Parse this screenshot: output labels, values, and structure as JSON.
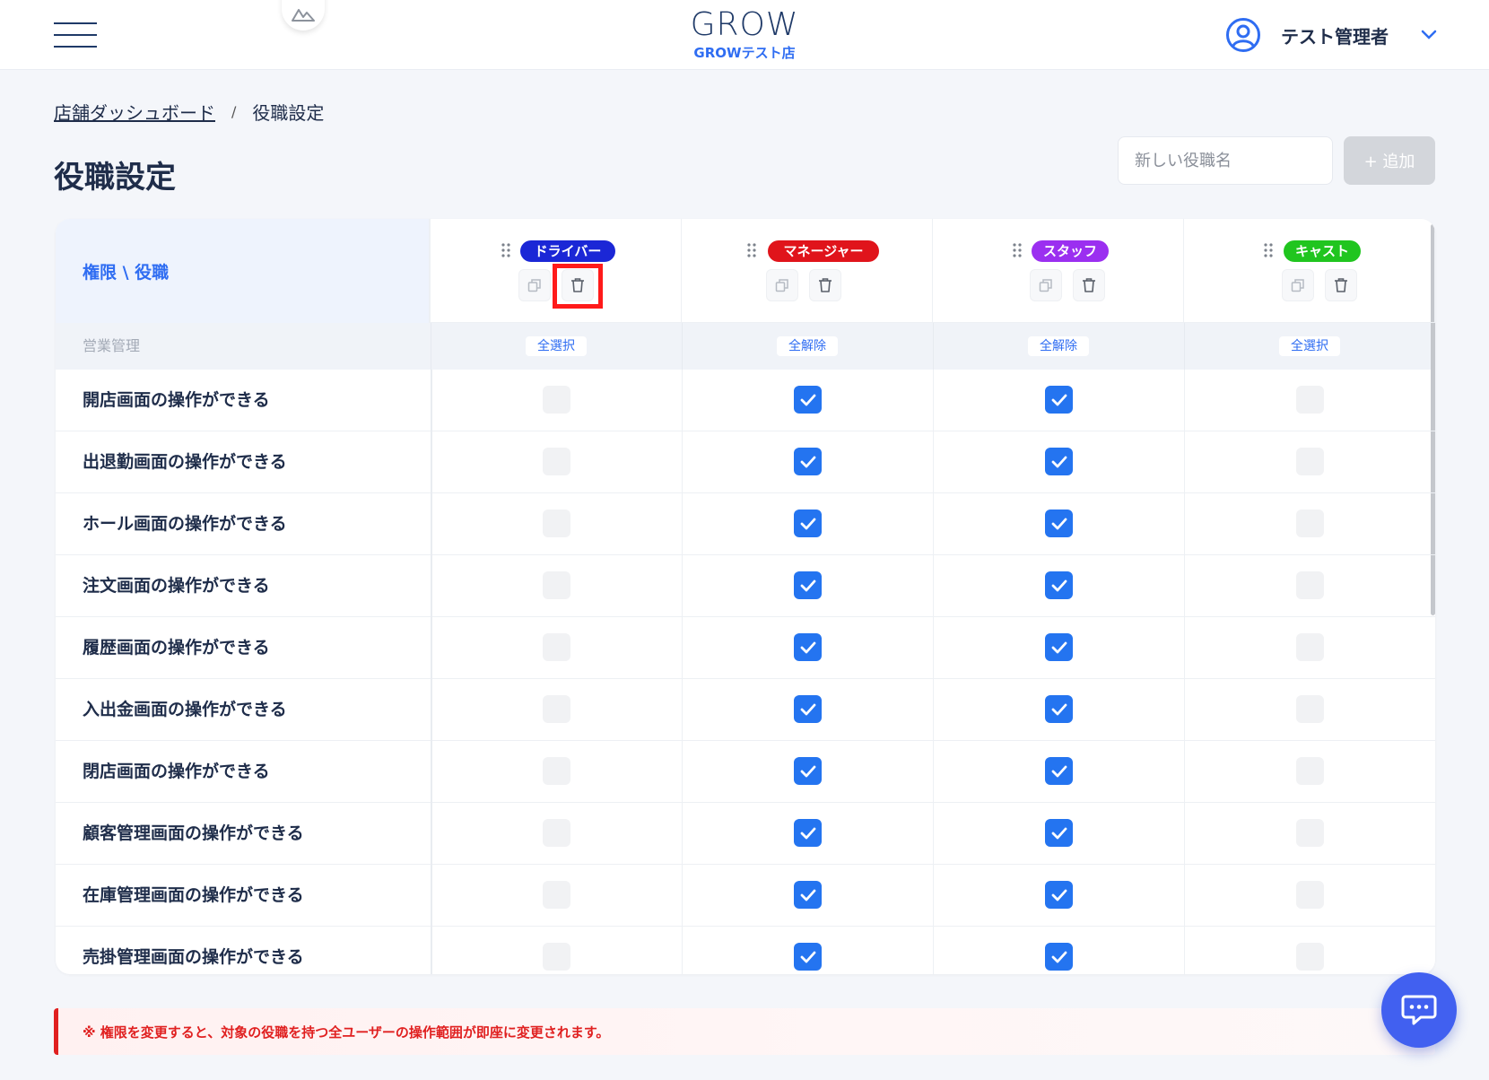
{
  "header": {
    "brand_title": "GROW",
    "brand_subtitle": "GROWテスト店",
    "user_name": "テスト管理者"
  },
  "breadcrumb": {
    "parent": "店舗ダッシュボード",
    "separator": "/",
    "current": "役職設定"
  },
  "page": {
    "title": "役職設定",
    "new_role_placeholder": "新しい役職名",
    "add_button_label": "+ 追加"
  },
  "table": {
    "corner_label": "権限 \\ 役職",
    "roles": [
      {
        "name": "ドライバー",
        "color": "#1b27d6"
      },
      {
        "name": "マネージャー",
        "color": "#e0141b"
      },
      {
        "name": "スタッフ",
        "color": "#9b2ff0"
      },
      {
        "name": "キャスト",
        "color": "#20c51f"
      }
    ],
    "section": {
      "name": "営業管理",
      "toggles": [
        "全選択",
        "全解除",
        "全解除",
        "全選択"
      ]
    },
    "permissions": [
      {
        "label": "開店画面の操作ができる",
        "values": [
          false,
          true,
          true,
          false
        ]
      },
      {
        "label": "出退勤画面の操作ができる",
        "values": [
          false,
          true,
          true,
          false
        ]
      },
      {
        "label": "ホール画面の操作ができる",
        "values": [
          false,
          true,
          true,
          false
        ]
      },
      {
        "label": "注文画面の操作ができる",
        "values": [
          false,
          true,
          true,
          false
        ]
      },
      {
        "label": "履歴画面の操作ができる",
        "values": [
          false,
          true,
          true,
          false
        ]
      },
      {
        "label": "入出金画面の操作ができる",
        "values": [
          false,
          true,
          true,
          false
        ]
      },
      {
        "label": "閉店画面の操作ができる",
        "values": [
          false,
          true,
          true,
          false
        ]
      },
      {
        "label": "顧客管理画面の操作ができる",
        "values": [
          false,
          true,
          true,
          false
        ]
      },
      {
        "label": "在庫管理画面の操作ができる",
        "values": [
          false,
          true,
          true,
          false
        ]
      },
      {
        "label": "売掛管理画面の操作ができる",
        "values": [
          false,
          true,
          true,
          false
        ]
      }
    ]
  },
  "warning": {
    "text": "※ 権限を変更すると、対象の役職を持つ全ユーザーの操作範囲が即座に変更されます。"
  },
  "icons": {
    "menu": "hamburger-menu-icon",
    "logo": "mountain-logo-icon",
    "user": "user-circle-icon",
    "chevron": "chevron-down-icon",
    "drag": "drag-handle-icon",
    "copy": "copy-icon",
    "delete": "trash-icon",
    "check": "check-icon",
    "chat": "chat-bubble-icon"
  },
  "colors": {
    "accent": "#2f6df2",
    "checkbox_checked": "#2474f0",
    "warning": "#e02020",
    "chat_fab": "#4160f0"
  }
}
